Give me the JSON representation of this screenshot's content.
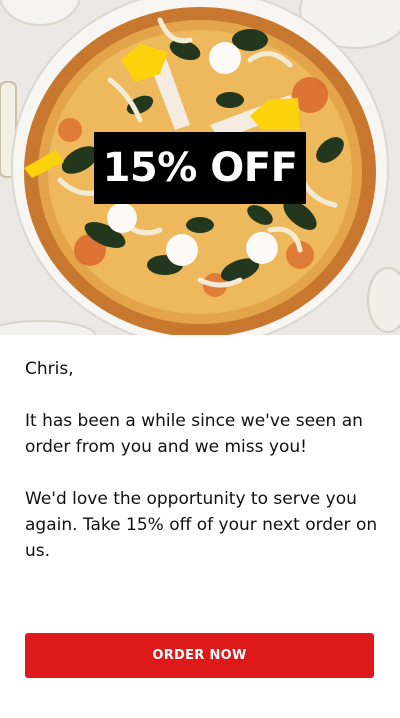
{
  "hero": {
    "image": "pizza-photo",
    "badge_text": "15% OFF"
  },
  "message": {
    "greeting": "Chris,",
    "paragraph1": "It has been a while since we've seen an order from you and we miss you!",
    "paragraph2": "We'd love the opportunity to serve you again. Take 15% off of your next order on us."
  },
  "cta": {
    "label": "ORDER NOW"
  },
  "colors": {
    "accent": "#de1919",
    "badge_bg": "#000000",
    "shape_yellow": "#fcd20c"
  }
}
